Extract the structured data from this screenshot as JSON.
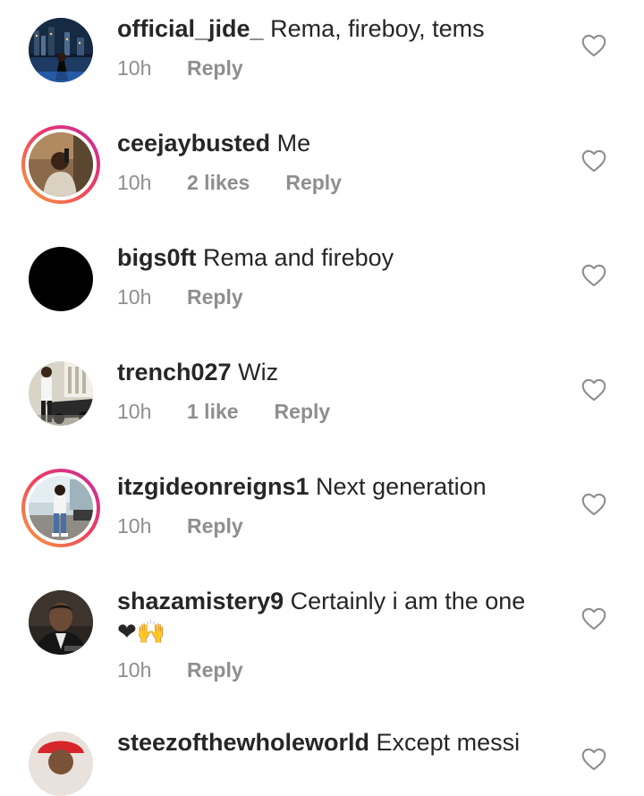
{
  "comments": [
    {
      "username": "official_jide_",
      "text": "Rema, fireboy, tems",
      "time": "10h",
      "likes": "",
      "reply": "Reply",
      "story_ring": false
    },
    {
      "username": "ceejaybusted",
      "text": "Me",
      "time": "10h",
      "likes": "2 likes",
      "reply": "Reply",
      "story_ring": true
    },
    {
      "username": "bigs0ft",
      "text": "Rema and fireboy",
      "time": "10h",
      "likes": "",
      "reply": "Reply",
      "story_ring": false
    },
    {
      "username": "trench027",
      "text": "Wiz",
      "time": "10h",
      "likes": "1 like",
      "reply": "Reply",
      "story_ring": false
    },
    {
      "username": "itzgideonreigns1",
      "text": "Next generation",
      "time": "10h",
      "likes": "",
      "reply": "Reply",
      "story_ring": true
    },
    {
      "username": "shazamistery9",
      "text": "Certainly i am the one",
      "text_line2": "❤🙌",
      "time": "10h",
      "likes": "",
      "reply": "Reply",
      "story_ring": false
    },
    {
      "username": "steezofthewholeworld",
      "text": "Except messi",
      "story_ring": false
    }
  ],
  "icons": {
    "like": "heart-outline-icon"
  },
  "colors": {
    "text": "#262626",
    "meta": "#8e8e8e",
    "ring_start": "#f9a23a",
    "ring_end": "#c32aa3"
  }
}
